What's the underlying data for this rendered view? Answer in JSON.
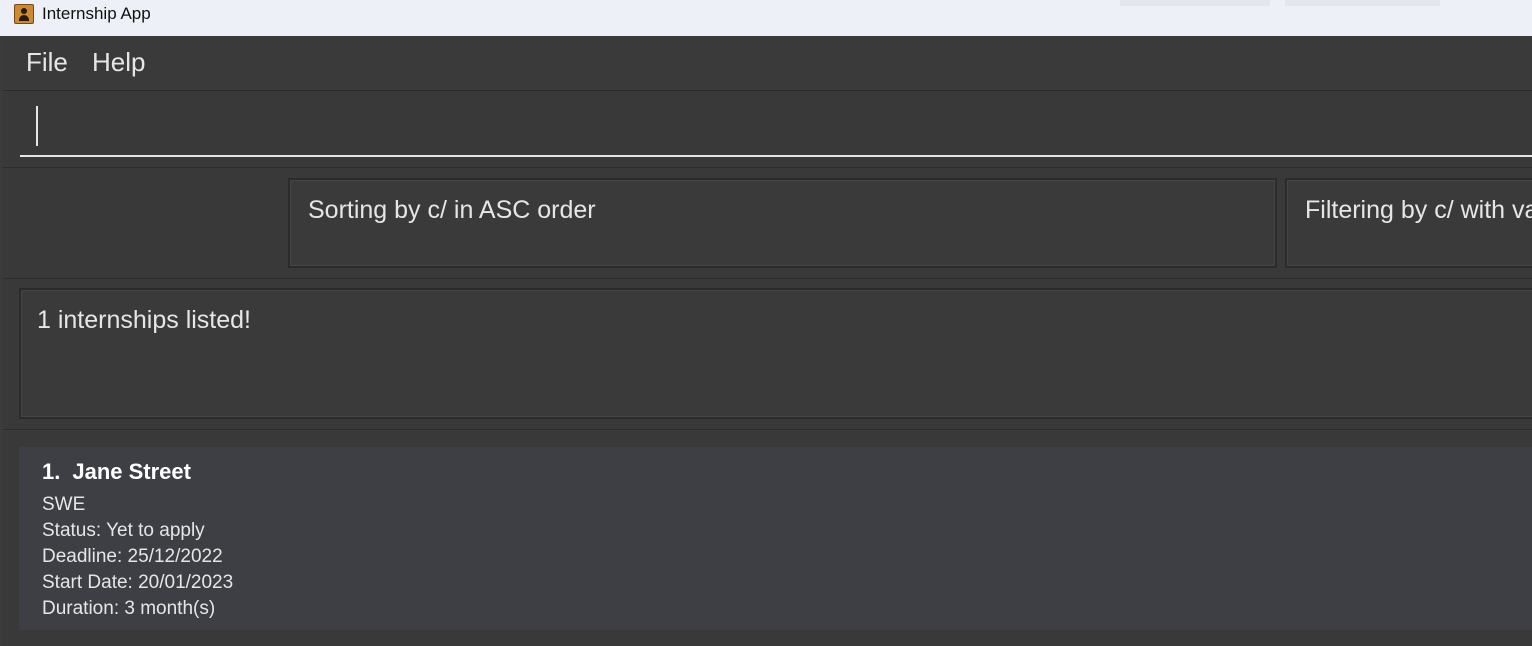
{
  "window": {
    "title": "Internship App"
  },
  "menu": {
    "file_label": "File",
    "help_label": "Help"
  },
  "command": {
    "value": ""
  },
  "sort_display": {
    "text": "Sorting by c/ in ASC order"
  },
  "filter_display": {
    "text": "Filtering by c/ with va"
  },
  "result_display": {
    "text": "1 internships listed!"
  },
  "internships": [
    {
      "index": "1.",
      "company": "Jane Street",
      "role": "SWE",
      "status": "Status: Yet to apply",
      "deadline": "Deadline: 25/12/2022",
      "start_date": "Start Date: 20/01/2023",
      "duration": "Duration: 3 month(s)"
    }
  ],
  "colors": {
    "background": "#3b3b3b",
    "card": "#3e3f44",
    "text": "#e6e6e6",
    "titlebar": "#eef0f7"
  }
}
